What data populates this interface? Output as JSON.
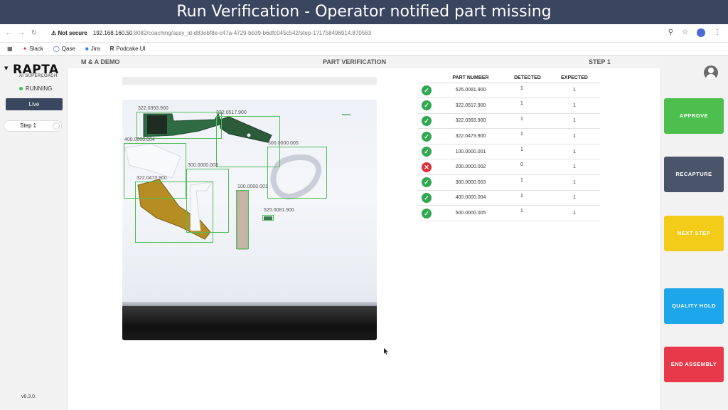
{
  "banner": {
    "title": "Run Verification - Operator notified part missing"
  },
  "browser": {
    "not_secure": "Not secure",
    "url_host": "192.168.160.50",
    "url_rest": ":8082/coaching/assy_id-d83ebf8e-c47a-4729-bb39-b6dfc045c542/step-1?1758496914.870563",
    "bookmarks": [
      {
        "label": "Slack",
        "icon": "slack-icon"
      },
      {
        "label": "Qase",
        "icon": "qase-icon"
      },
      {
        "label": "Jira",
        "icon": "jira-icon"
      },
      {
        "label": "Podcake UI",
        "icon": "podcake-icon"
      }
    ]
  },
  "sidebar": {
    "logo": "RAPTA",
    "logo_sub": "AI SUPERCOACH",
    "status": "RUNNING",
    "live": "Live",
    "step": "Step 1",
    "version": "v8.3.0."
  },
  "topbar": {
    "left": "M & A DEMO",
    "mid": "PART VERIFICATION",
    "right": "STEP 1"
  },
  "camera": {
    "labels": [
      "322.0393.900",
      "322.0517.900",
      "400.0000.004",
      "500.0000.005",
      "322.0473.900",
      "300.0000.003",
      "100.0000.001",
      "525.0081.900"
    ]
  },
  "table": {
    "headers": {
      "part": "PART NUMBER",
      "detected": "DETECTED",
      "expected": "EXPECTED"
    },
    "rows": [
      {
        "status": "ok",
        "part": "525.0081.900",
        "detected": "1",
        "expected": "1"
      },
      {
        "status": "ok",
        "part": "322.0517.900",
        "detected": "1",
        "expected": "1"
      },
      {
        "status": "ok",
        "part": "322.0393.900",
        "detected": "1",
        "expected": "1"
      },
      {
        "status": "ok",
        "part": "322.0473.900",
        "detected": "1",
        "expected": "1"
      },
      {
        "status": "ok",
        "part": "100.0000.001",
        "detected": "1",
        "expected": "1"
      },
      {
        "status": "missing",
        "part": "200.0000.002",
        "detected": "0",
        "expected": "1"
      },
      {
        "status": "ok",
        "part": "300.0000.003",
        "detected": "1",
        "expected": "1"
      },
      {
        "status": "ok",
        "part": "400.0000.004",
        "detected": "1",
        "expected": "1"
      },
      {
        "status": "ok",
        "part": "500.0000.005",
        "detected": "1",
        "expected": "1"
      }
    ]
  },
  "actions": {
    "approve": {
      "label": "APPROVE",
      "color": "#4cbf4e"
    },
    "recapture": {
      "label": "RECAPTURE",
      "color": "#4a556a"
    },
    "next_step": {
      "label": "NEXT STEP",
      "color": "#f2cc19"
    },
    "quality_hold": {
      "label": "QUALITY HOLD",
      "color": "#1ea6ea"
    },
    "end_assembly": {
      "label": "END ASSEMBLY",
      "color": "#e8394a"
    }
  }
}
